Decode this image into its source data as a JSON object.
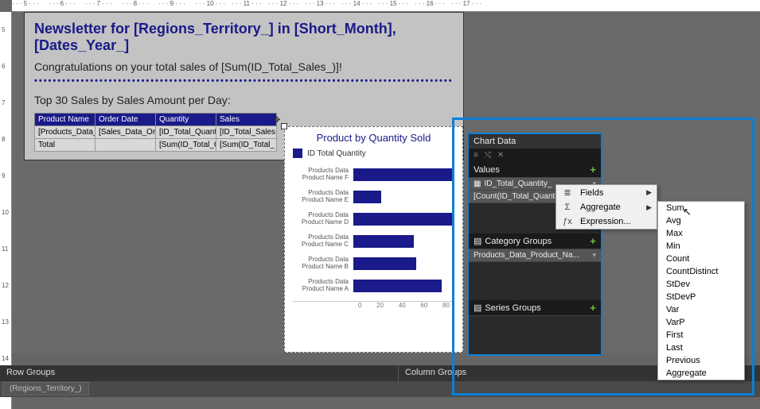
{
  "ruler_marks_top": [
    "5",
    "6",
    "7",
    "8",
    "9",
    "10",
    "11",
    "12",
    "13",
    "14",
    "15",
    "16",
    "17"
  ],
  "ruler_marks_left": [
    "5",
    "6",
    "7",
    "8",
    "9",
    "10",
    "11",
    "12",
    "13",
    "14"
  ],
  "page": {
    "title": "Newsletter for [Regions_Territory_] in [Short_Month], [Dates_Year_]",
    "congrats": "Congratulations on your total sales of [Sum(ID_Total_Sales_)]!",
    "section_heading": "Top 30 Sales by Sales Amount per Day:",
    "table": {
      "headers": [
        "Product Name",
        "Order Date",
        "Quantity",
        "Sales"
      ],
      "rows": [
        [
          "[Products_Data_",
          "[Sales_Data_Ord",
          "[ID_Total_Quant",
          "[ID_Total_Sales"
        ],
        [
          "Total",
          "",
          "[Sum(ID_Total_Q",
          "[Sum(ID_Total_"
        ]
      ]
    }
  },
  "chart_data": {
    "type": "bar",
    "title": "Product by Quantity Sold",
    "legend": "ID Total Quantity",
    "categories": [
      "Products Data Product Name F",
      "Products Data Product Name E",
      "Products Data Product Name D",
      "Products Data Product Name C",
      "Products Data Product Name B",
      "Products Data Product Name A"
    ],
    "values": [
      80,
      22,
      80,
      48,
      50,
      70
    ],
    "xlabel": "",
    "ylabel": "",
    "xlim": [
      0,
      80
    ],
    "ticks": [
      "0",
      "20",
      "40",
      "60",
      "80"
    ]
  },
  "chart_panel": {
    "header": "Chart Data",
    "values_hdr": "Values",
    "values": [
      "ID_Total_Quantity_",
      "[Count(ID_Total_Quanti..."
    ],
    "category_hdr": "Category Groups",
    "categories": [
      "Products_Data_Product_Na..."
    ],
    "series_hdr": "Series Groups"
  },
  "context_menu": {
    "items": [
      {
        "icon": "≣",
        "label": "Fields",
        "arrow": true
      },
      {
        "icon": "Σ",
        "label": "Aggregate",
        "arrow": true
      },
      {
        "icon": "ƒx",
        "label": "Expression...",
        "arrow": false
      }
    ]
  },
  "aggregate_submenu": [
    "Sum",
    "Avg",
    "Max",
    "Min",
    "Count",
    "CountDistinct",
    "StDev",
    "StDevP",
    "Var",
    "VarP",
    "First",
    "Last",
    "Previous",
    "Aggregate"
  ],
  "bottom": {
    "row_groups": "Row Groups",
    "column_groups": "Column Groups",
    "rg_item": "(Regions_Territory_)"
  }
}
